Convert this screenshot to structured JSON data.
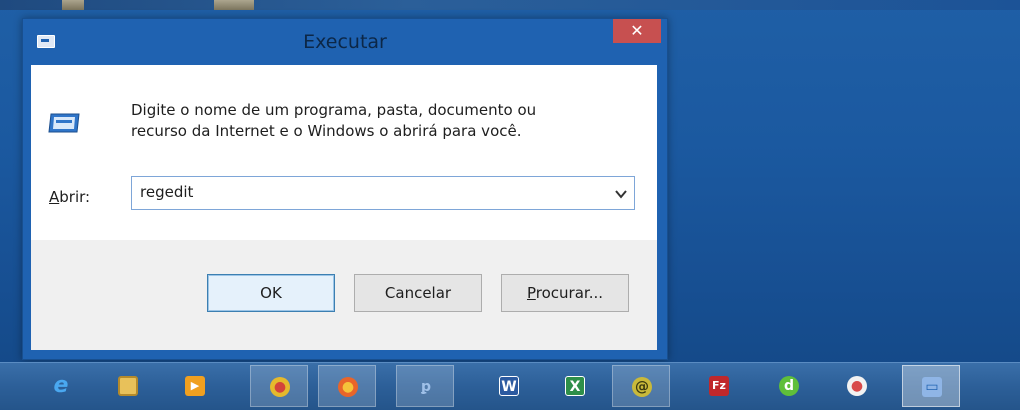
{
  "window": {
    "title": "Executar",
    "close_glyph": "✕",
    "description": "Digite o nome de um programa, pasta, documento ou\nrecurso da Internet e o Windows o abrirá para você.",
    "open_label_access_key": "A",
    "open_label_rest": "brir:",
    "open_value": "regedit"
  },
  "buttons": {
    "ok": "OK",
    "cancel": "Cancelar",
    "browse_access_key": "P",
    "browse_rest": "rocurar..."
  },
  "taskbar": {
    "items": [
      {
        "icon": "internet-explorer-icon",
        "color": "#2f8fe0",
        "glyph": "e"
      },
      {
        "icon": "file-explorer-icon",
        "color": "#e8c15a",
        "glyph": ""
      },
      {
        "icon": "media-player-icon",
        "color": "#f0a020",
        "glyph": "▶"
      },
      {
        "icon": "chrome-icon",
        "color": "#e5b92c",
        "glyph": "●"
      },
      {
        "icon": "firefox-icon",
        "color": "#e8652a",
        "glyph": "●"
      },
      {
        "icon": "python-icon",
        "color": "#5b87c2",
        "glyph": "ꝑ"
      },
      {
        "icon": "word-icon",
        "color": "#2c5aa0",
        "glyph": "W"
      },
      {
        "icon": "excel-icon",
        "color": "#2f8f4a",
        "glyph": "X"
      },
      {
        "icon": "app-icon",
        "color": "#c9b93a",
        "glyph": "@"
      },
      {
        "icon": "filezilla-icon",
        "color": "#c0282b",
        "glyph": "Fz"
      },
      {
        "icon": "dreamweaver-icon",
        "color": "#5fbf3a",
        "glyph": "d"
      },
      {
        "icon": "app-icon-2",
        "color": "#d84a4a",
        "glyph": "●"
      },
      {
        "icon": "run-icon",
        "color": "#8fb5e6",
        "glyph": "▭"
      }
    ]
  }
}
